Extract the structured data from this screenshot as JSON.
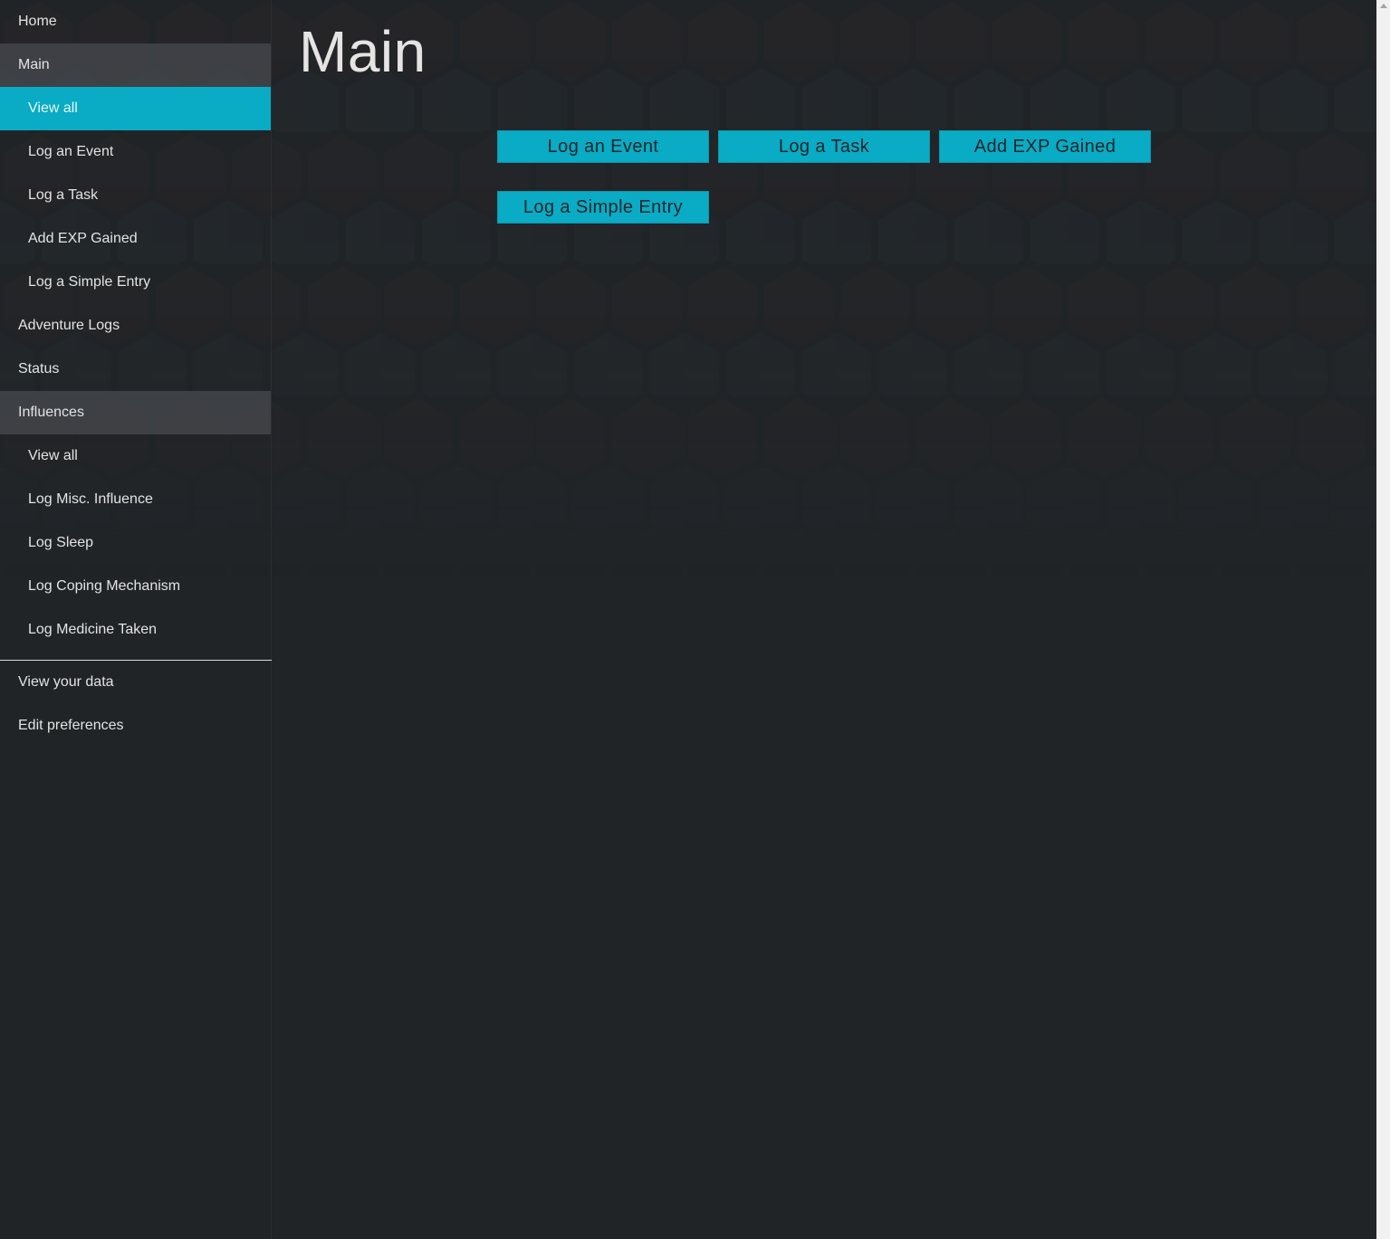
{
  "sidebar": {
    "top_items": [
      {
        "label": "Home"
      },
      {
        "label": "Main"
      }
    ],
    "main_children": [
      {
        "label": "View all",
        "active": true
      },
      {
        "label": "Log an Event"
      },
      {
        "label": "Log a Task"
      },
      {
        "label": "Add EXP Gained"
      },
      {
        "label": "Log a Simple Entry"
      }
    ],
    "mid_items": [
      {
        "label": "Adventure Logs"
      },
      {
        "label": "Status"
      },
      {
        "label": "Influences"
      }
    ],
    "influences_children": [
      {
        "label": "View all"
      },
      {
        "label": "Log Misc. Influence"
      },
      {
        "label": "Log Sleep"
      },
      {
        "label": "Log Coping Mechanism"
      },
      {
        "label": "Log Medicine Taken"
      }
    ],
    "bottom_items": [
      {
        "label": "View your data"
      },
      {
        "label": "Edit preferences"
      }
    ]
  },
  "main": {
    "title": "Main",
    "buttons": [
      {
        "label": "Log an Event"
      },
      {
        "label": "Log a Task"
      },
      {
        "label": "Add EXP Gained"
      },
      {
        "label": "Log a Simple Entry"
      }
    ]
  },
  "colors": {
    "accent": "#0aabc4",
    "background": "#212427",
    "text": "#e3e3e3"
  }
}
